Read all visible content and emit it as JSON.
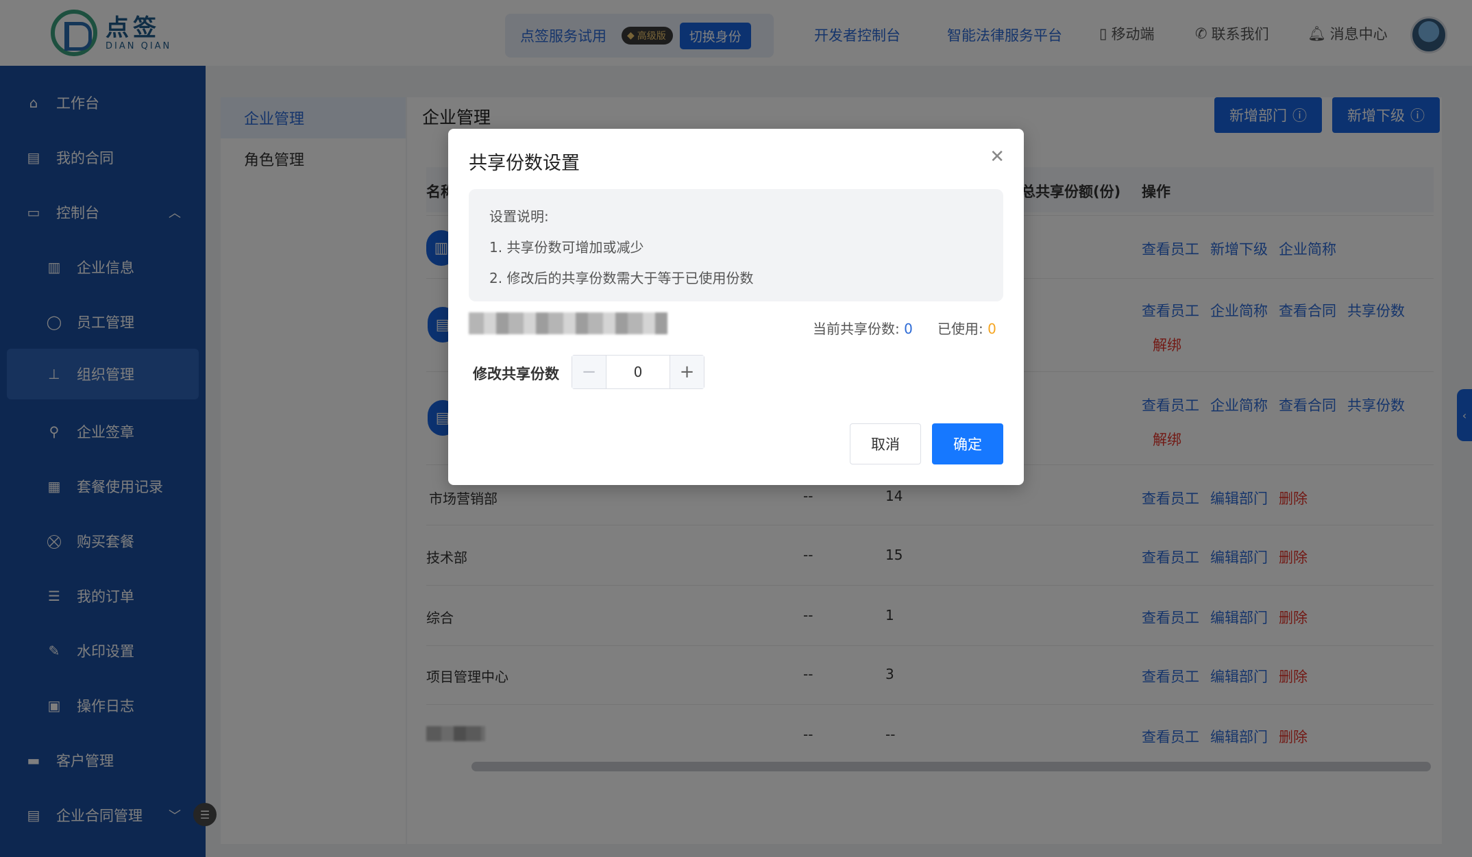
{
  "header": {
    "logo_cn": "点签",
    "logo_en": "DIAN QIAN",
    "trial_text": "点签服务试用",
    "vip_badge": "高级版",
    "switch_identity": "切换身份",
    "nav": {
      "developer": "开发者控制台",
      "legal": "智能法律服务平台",
      "mobile": "移动端",
      "contact": "联系我们",
      "messages": "消息中心"
    }
  },
  "sidebar": {
    "items": [
      {
        "label": "工作台",
        "icon": "home-icon"
      },
      {
        "label": "我的合同",
        "icon": "clipboard-icon"
      },
      {
        "label": "控制台",
        "icon": "console-icon"
      },
      {
        "label": "企业信息",
        "icon": "building-icon"
      },
      {
        "label": "员工管理",
        "icon": "user-icon"
      },
      {
        "label": "组织管理",
        "icon": "org-tree-icon"
      },
      {
        "label": "企业签章",
        "icon": "stamp-icon"
      },
      {
        "label": "套餐使用记录",
        "icon": "record-icon"
      },
      {
        "label": "购买套餐",
        "icon": "cart-icon"
      },
      {
        "label": "我的订单",
        "icon": "order-icon"
      },
      {
        "label": "水印设置",
        "icon": "pen-icon"
      },
      {
        "label": "操作日志",
        "icon": "log-icon"
      },
      {
        "label": "客户管理",
        "icon": "briefcase-icon"
      },
      {
        "label": "企业合同管理",
        "icon": "contract-icon"
      }
    ]
  },
  "subpanel": {
    "items": [
      "企业管理",
      "角色管理"
    ]
  },
  "main": {
    "title": "企业管理",
    "add_dept": "新增部门",
    "add_sub": "新增下级",
    "columns": {
      "name": "名称",
      "total_share": "总共享份额(份)",
      "actions": "操作"
    },
    "rows": [
      {
        "name": "",
        "col2": "",
        "col3": "",
        "actions": [
          "查看员工",
          "新增下级",
          "企业简称"
        ],
        "danger": []
      },
      {
        "name": "",
        "col2": "",
        "col3": "",
        "actions": [
          "查看员工",
          "企业简称",
          "查看合同",
          "共享份数"
        ],
        "danger": [
          "解绑"
        ]
      },
      {
        "name": "",
        "col2": "",
        "col3": "",
        "actions": [
          "查看员工",
          "企业简称",
          "查看合同",
          "共享份数"
        ],
        "danger": [
          "解绑"
        ]
      },
      {
        "name": "市场营销部",
        "col2": "--",
        "col3": "14",
        "actions": [
          "查看员工",
          "编辑部门"
        ],
        "danger": [
          "删除"
        ]
      },
      {
        "name": "技术部",
        "col2": "--",
        "col3": "15",
        "actions": [
          "查看员工",
          "编辑部门"
        ],
        "danger": [
          "删除"
        ]
      },
      {
        "name": "综合",
        "col2": "--",
        "col3": "1",
        "actions": [
          "查看员工",
          "编辑部门"
        ],
        "danger": [
          "删除"
        ]
      },
      {
        "name": "项目管理中心",
        "col2": "--",
        "col3": "3",
        "actions": [
          "查看员工",
          "编辑部门"
        ],
        "danger": [
          "删除"
        ]
      },
      {
        "name": "",
        "col2": "--",
        "col3": "--",
        "actions": [
          "查看员工",
          "编辑部门"
        ],
        "danger": [
          "删除"
        ]
      }
    ]
  },
  "modal": {
    "title": "共享份数设置",
    "notice_title": "设置说明:",
    "notice_1": "1. 共享份数可增加或减少",
    "notice_2": "2. 修改后的共享份数需大于等于已使用份数",
    "current_label": "当前共享份数:",
    "current_value": "0",
    "used_label": "已使用:",
    "used_value": "0",
    "edit_label": "修改共享份数",
    "stepper_value": "0",
    "cancel": "取消",
    "confirm": "确定"
  },
  "colors": {
    "sidebar_bg": "#1b4ea0",
    "primary": "#1865e0",
    "link": "#2d6bd6",
    "danger": "#e5352b",
    "warning": "#f5a623"
  }
}
